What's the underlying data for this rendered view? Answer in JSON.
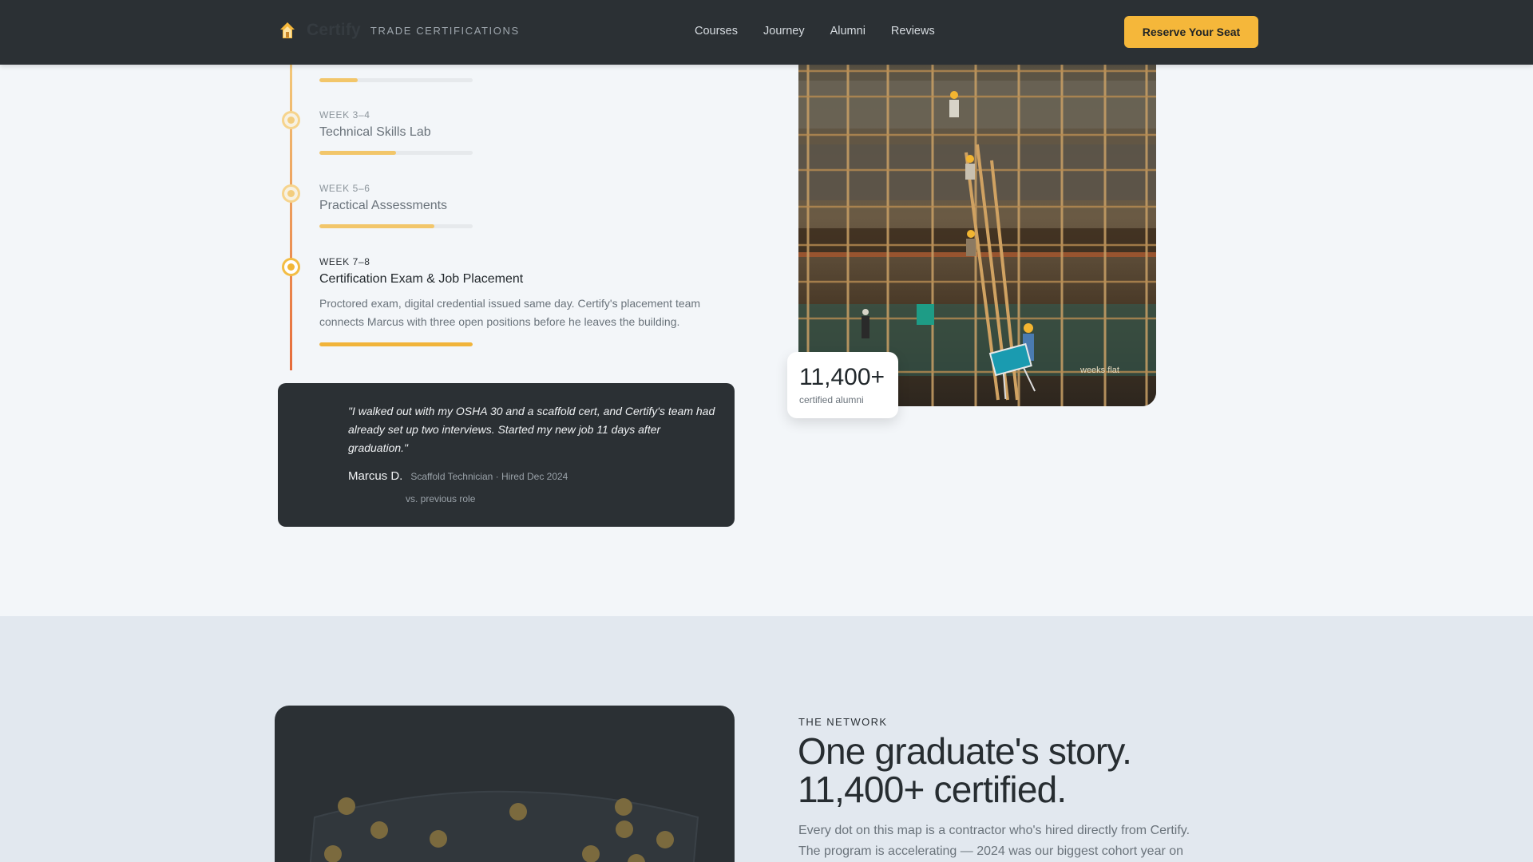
{
  "brand": {
    "name": "Certify",
    "tagline": "TRADE CERTIFICATIONS",
    "accent": "#f5b73a",
    "logo_icon": "house-icon"
  },
  "nav": {
    "links": [
      "Courses",
      "Journey",
      "Alumni",
      "Reviews"
    ],
    "cta": "Reserve Your Seat"
  },
  "timeline": {
    "weeks": [
      {
        "label": "WEEK 3–4",
        "title": "Technical Skills Lab",
        "progress": 0.5
      },
      {
        "label": "WEEK 5–6",
        "title": "Practical Assessments",
        "progress": 0.75
      },
      {
        "label": "WEEK 7–8",
        "title": "Certification Exam & Job Placement",
        "description": "Proctored exam, digital credential issued same day. Certify's placement team connects Marcus with three open positions before he leaves the building.",
        "progress": 1.0
      }
    ],
    "first_progress": 0.25
  },
  "testimonial": {
    "quote": "\"I walked out with my OSHA 30 and a scaffold cert, and Certify's team had already set up two interviews. Started my new job 11 days after graduation.\"",
    "author": "Marcus D.",
    "role": "Scaffold Technician · Hired Dec 2024",
    "comparison": "vs. previous role"
  },
  "photo": {
    "overlay_text": "weeks flat"
  },
  "stat": {
    "value": "11,400+",
    "label": "certified alumni"
  },
  "network": {
    "eyebrow": "THE NETWORK",
    "headline_line1": "One graduate's story.",
    "headline_line2": "11,400+ certified.",
    "lede": "Every dot on this map is a contractor who's hired directly from Certify. The program is accelerating — 2024 was our biggest cohort year on"
  }
}
